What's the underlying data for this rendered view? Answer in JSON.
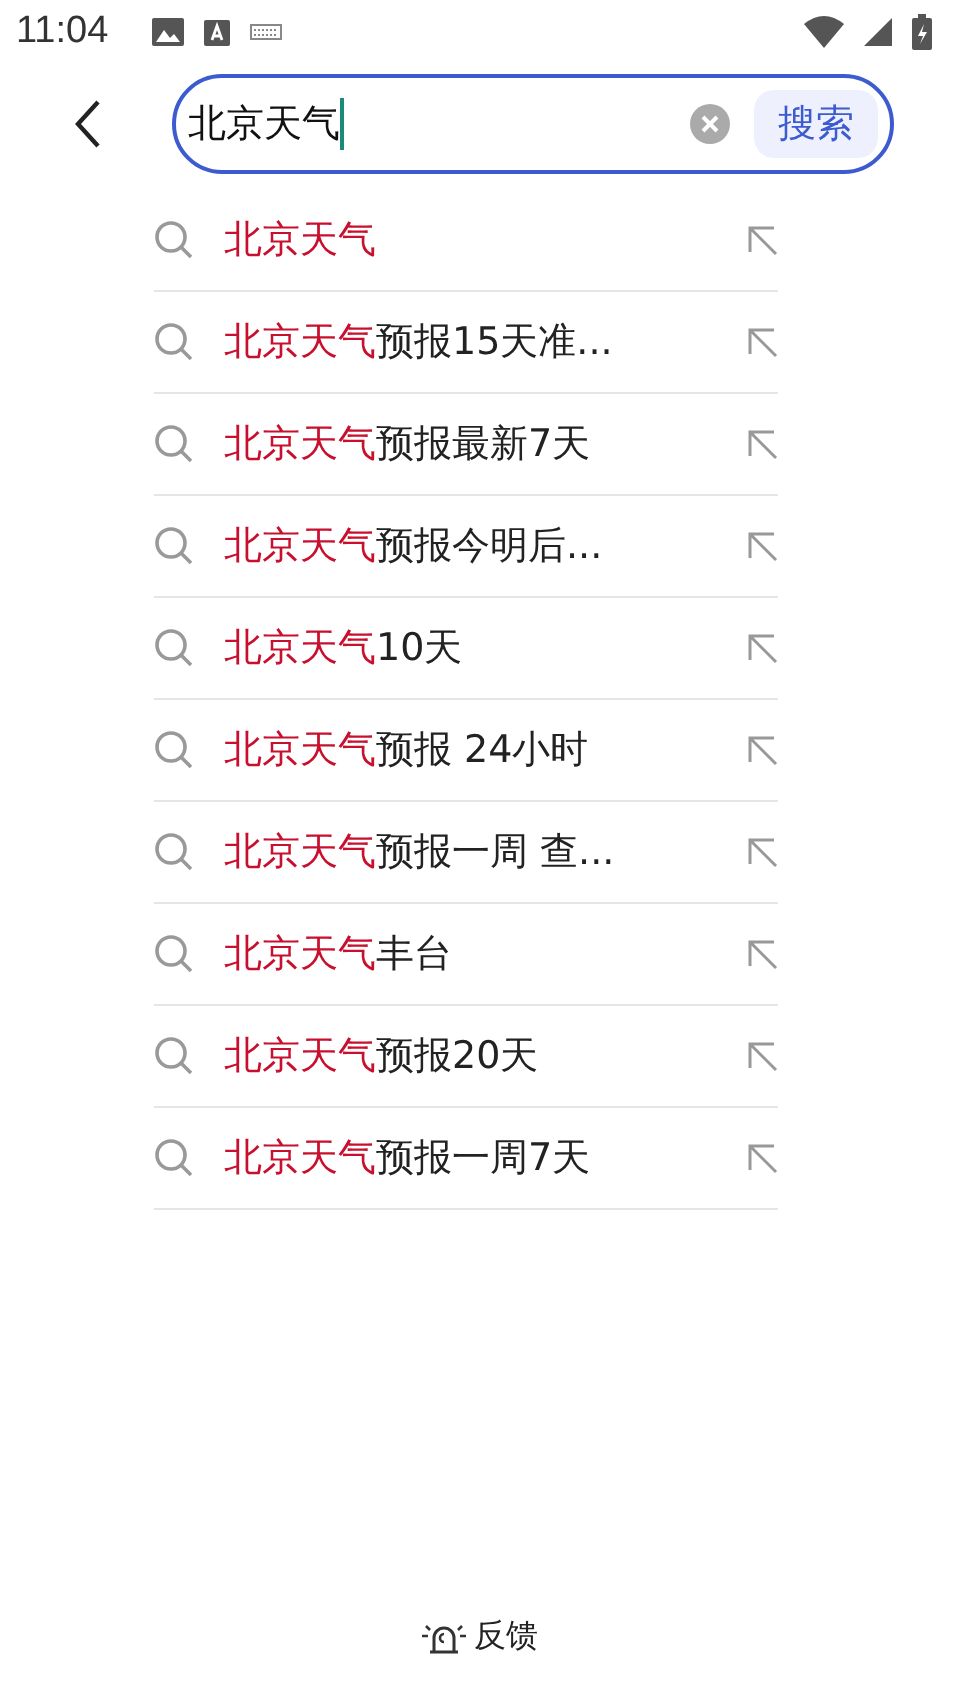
{
  "status_bar": {
    "time": "11:04"
  },
  "search": {
    "value": "北京天气",
    "button": "搜索"
  },
  "suggestions": [
    {
      "match": "北京天气"
    },
    {
      "match": "北京天气",
      "rest": "预报15天准..."
    },
    {
      "match": "北京天气",
      "rest": "预报最新7天"
    },
    {
      "match": "北京天气",
      "rest": "预报今明后..."
    },
    {
      "match": "北京天气",
      "rest": "10天"
    },
    {
      "match": "北京天气",
      "rest": "预报 24小时"
    },
    {
      "match": "北京天气",
      "rest": "预报一周 查..."
    },
    {
      "match": "北京天气",
      "rest": "丰台"
    },
    {
      "match": "北京天气",
      "rest": "预报20天"
    },
    {
      "match": "北京天气",
      "rest": "预报一周7天"
    }
  ],
  "feedback": "反馈"
}
